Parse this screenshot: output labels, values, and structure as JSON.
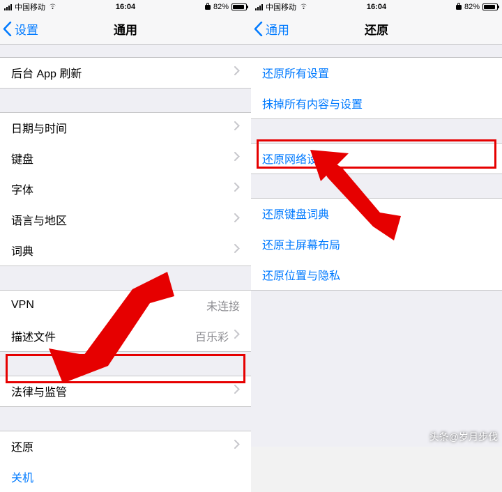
{
  "status": {
    "carrier": "中国移动",
    "time": "16:04",
    "lock_icon": "lock-icon",
    "battery_text": "82%"
  },
  "left": {
    "back_label": "设置",
    "title": "通用",
    "groups": [
      {
        "cells": [
          {
            "label": "后台 App 刷新",
            "type": "chevron"
          }
        ]
      },
      {
        "cells": [
          {
            "label": "日期与时间",
            "type": "chevron"
          },
          {
            "label": "键盘",
            "type": "chevron"
          },
          {
            "label": "字体",
            "type": "chevron"
          },
          {
            "label": "语言与地区",
            "type": "chevron"
          },
          {
            "label": "词典",
            "type": "chevron"
          }
        ]
      },
      {
        "cells": [
          {
            "label": "VPN",
            "type": "value",
            "value": "未连接"
          },
          {
            "label": "描述文件",
            "type": "value-chevron",
            "value": "百乐彩"
          }
        ]
      },
      {
        "cells": [
          {
            "label": "法律与监管",
            "type": "chevron"
          }
        ]
      },
      {
        "cells": [
          {
            "label": "还原",
            "type": "chevron",
            "highlight": true
          },
          {
            "label": "关机",
            "type": "action"
          }
        ]
      }
    ]
  },
  "right": {
    "back_label": "通用",
    "title": "还原",
    "groups": [
      {
        "cells": [
          {
            "label": "还原所有设置",
            "type": "action"
          },
          {
            "label": "抹掉所有内容与设置",
            "type": "action"
          }
        ]
      },
      {
        "cells": [
          {
            "label": "还原网络设置",
            "type": "action",
            "highlight": true
          }
        ]
      },
      {
        "cells": [
          {
            "label": "还原键盘词典",
            "type": "action"
          },
          {
            "label": "还原主屏幕布局",
            "type": "action"
          },
          {
            "label": "还原位置与隐私",
            "type": "action"
          }
        ]
      }
    ]
  },
  "watermark": "头条@岁月步伐"
}
